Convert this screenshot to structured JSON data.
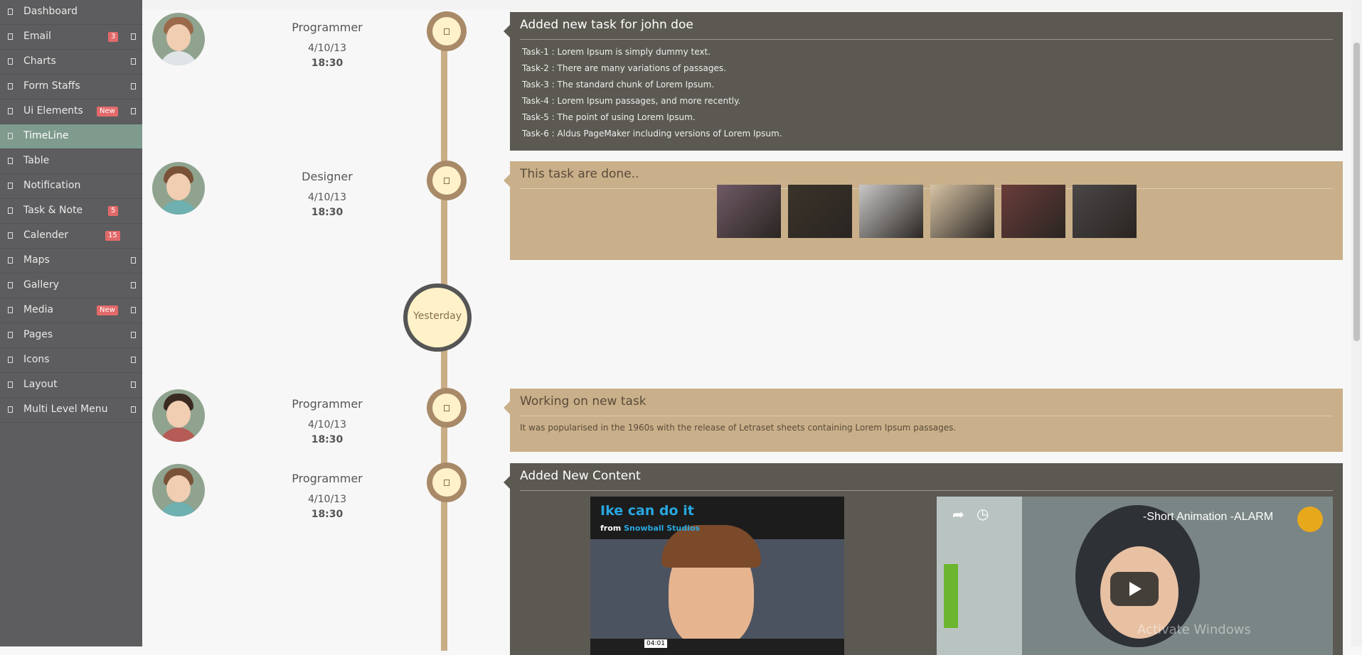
{
  "sidebar": {
    "items": [
      {
        "label": "Dashboard",
        "badge": "",
        "has_caret": false,
        "active": false
      },
      {
        "label": "Email",
        "badge": "3",
        "has_caret": true,
        "active": false
      },
      {
        "label": "Charts",
        "badge": "",
        "has_caret": true,
        "active": false
      },
      {
        "label": "Form Staffs",
        "badge": "",
        "has_caret": true,
        "active": false
      },
      {
        "label": "Ui Elements",
        "badge": "New",
        "has_caret": true,
        "active": false
      },
      {
        "label": "TimeLine",
        "badge": "",
        "has_caret": false,
        "active": true
      },
      {
        "label": "Table",
        "badge": "",
        "has_caret": false,
        "active": false
      },
      {
        "label": "Notification",
        "badge": "",
        "has_caret": false,
        "active": false
      },
      {
        "label": "Task & Note",
        "badge": "5",
        "has_caret": false,
        "active": false
      },
      {
        "label": "Calender",
        "badge": "15",
        "has_caret": false,
        "active": false
      },
      {
        "label": "Maps",
        "badge": "",
        "has_caret": true,
        "active": false
      },
      {
        "label": "Gallery",
        "badge": "",
        "has_caret": true,
        "active": false
      },
      {
        "label": "Media",
        "badge": "New",
        "has_caret": true,
        "active": false
      },
      {
        "label": "Pages",
        "badge": "",
        "has_caret": true,
        "active": false
      },
      {
        "label": "Icons",
        "badge": "",
        "has_caret": true,
        "active": false
      },
      {
        "label": "Layout",
        "badge": "",
        "has_caret": true,
        "active": false
      },
      {
        "label": "Multi Level Menu",
        "badge": "",
        "has_caret": true,
        "active": false
      }
    ]
  },
  "timeline": {
    "entries": [
      {
        "role": "Programmer",
        "date": "4/10/13",
        "time": "18:30"
      },
      {
        "role": "Designer",
        "date": "4/10/13",
        "time": "18:30"
      },
      {
        "role": "Programmer",
        "date": "4/10/13",
        "time": "18:30"
      },
      {
        "role": "Programmer",
        "date": "4/10/13",
        "time": "18:30"
      }
    ],
    "divider_label": "Yesterday"
  },
  "panels": {
    "tasks": {
      "title": "Added new task for john doe",
      "lines": [
        "Task-1 : Lorem Ipsum is simply dummy text.",
        "Task-2 : There are many variations of passages.",
        "Task-3 : The standard chunk of Lorem Ipsum.",
        "Task-4 : Lorem Ipsum passages, and more recently.",
        "Task-5 : The point of using Lorem Ipsum.",
        "Task-6 : Aldus PageMaker including versions of Lorem Ipsum."
      ]
    },
    "done": {
      "title": "This task are done..",
      "thumb_colors": [
        "#6f5a66",
        "#3a3329",
        "#c8c7c6",
        "#d7c4a6",
        "#6a3d3a",
        "#4a4747"
      ]
    },
    "working": {
      "title": "Working on new task",
      "text": "It was popularised in the 1960s with the release of Letraset sheets containing Lorem Ipsum passages."
    },
    "content": {
      "title": "Added New Content",
      "video1": {
        "title": "Ike can do it",
        "from_label": "from",
        "studio": "Snowball Studios",
        "duration": "04:01"
      },
      "video2": {
        "title": "-Short Animation -ALARM"
      }
    }
  },
  "watermark": "Activate Windows"
}
